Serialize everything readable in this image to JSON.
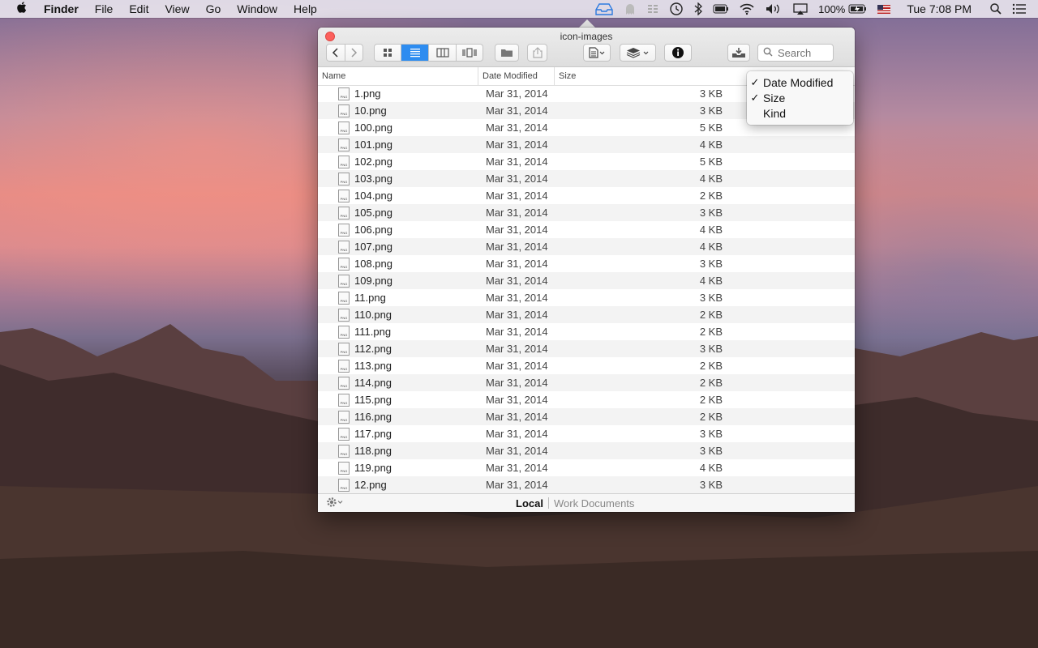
{
  "menubar": {
    "apple": "",
    "app": "Finder",
    "items": [
      "File",
      "Edit",
      "View",
      "Go",
      "Window",
      "Help"
    ],
    "battery": "100%",
    "clock": "Tue 7:08 PM"
  },
  "window": {
    "title": "icon-images",
    "search_placeholder": "Search",
    "columns": {
      "name": "Name",
      "date": "Date Modified",
      "size": "Size"
    },
    "files": [
      {
        "name": "1.png",
        "date": "Mar 31, 2014",
        "size": "3 KB"
      },
      {
        "name": "10.png",
        "date": "Mar 31, 2014",
        "size": "3 KB"
      },
      {
        "name": "100.png",
        "date": "Mar 31, 2014",
        "size": "5 KB"
      },
      {
        "name": "101.png",
        "date": "Mar 31, 2014",
        "size": "4 KB"
      },
      {
        "name": "102.png",
        "date": "Mar 31, 2014",
        "size": "5 KB"
      },
      {
        "name": "103.png",
        "date": "Mar 31, 2014",
        "size": "4 KB"
      },
      {
        "name": "104.png",
        "date": "Mar 31, 2014",
        "size": "2 KB"
      },
      {
        "name": "105.png",
        "date": "Mar 31, 2014",
        "size": "3 KB"
      },
      {
        "name": "106.png",
        "date": "Mar 31, 2014",
        "size": "4 KB"
      },
      {
        "name": "107.png",
        "date": "Mar 31, 2014",
        "size": "4 KB"
      },
      {
        "name": "108.png",
        "date": "Mar 31, 2014",
        "size": "3 KB"
      },
      {
        "name": "109.png",
        "date": "Mar 31, 2014",
        "size": "4 KB"
      },
      {
        "name": "11.png",
        "date": "Mar 31, 2014",
        "size": "3 KB"
      },
      {
        "name": "110.png",
        "date": "Mar 31, 2014",
        "size": "2 KB"
      },
      {
        "name": "111.png",
        "date": "Mar 31, 2014",
        "size": "2 KB"
      },
      {
        "name": "112.png",
        "date": "Mar 31, 2014",
        "size": "3 KB"
      },
      {
        "name": "113.png",
        "date": "Mar 31, 2014",
        "size": "2 KB"
      },
      {
        "name": "114.png",
        "date": "Mar 31, 2014",
        "size": "2 KB"
      },
      {
        "name": "115.png",
        "date": "Mar 31, 2014",
        "size": "2 KB"
      },
      {
        "name": "116.png",
        "date": "Mar 31, 2014",
        "size": "2 KB"
      },
      {
        "name": "117.png",
        "date": "Mar 31, 2014",
        "size": "3 KB"
      },
      {
        "name": "118.png",
        "date": "Mar 31, 2014",
        "size": "3 KB"
      },
      {
        "name": "119.png",
        "date": "Mar 31, 2014",
        "size": "4 KB"
      },
      {
        "name": "12.png",
        "date": "Mar 31, 2014",
        "size": "3 KB"
      }
    ],
    "status": {
      "local": "Local",
      "other": "Work Documents"
    }
  },
  "popup": {
    "items": [
      {
        "label": "Date Modified",
        "checked": true
      },
      {
        "label": "Size",
        "checked": true
      },
      {
        "label": "Kind",
        "checked": false
      }
    ]
  },
  "icons": {
    "apple": "apple-icon",
    "back": "chevron-left-icon",
    "forward": "chevron-right-icon",
    "icon_view": "grid-icon",
    "list_view": "list-icon",
    "column_view": "columns-icon",
    "cover_flow": "coverflow-icon",
    "new_folder": "folder-icon",
    "share": "share-icon",
    "doc": "document-icon",
    "layers": "layers-icon",
    "info": "info-icon",
    "download": "download-icon",
    "search": "search-icon",
    "gear": "gear-icon"
  },
  "colors": {
    "accent": "#2d8cf0",
    "close": "#fc605c"
  }
}
